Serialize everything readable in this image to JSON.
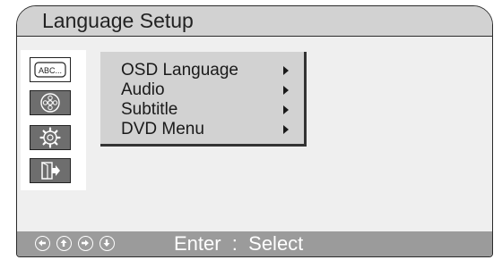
{
  "title": "Language Setup",
  "sidebar": {
    "items": [
      {
        "icon": "abc-language-icon",
        "label": "ABC...",
        "selected": true
      },
      {
        "icon": "disc-icon",
        "selected": false
      },
      {
        "icon": "gear-icon",
        "selected": false
      },
      {
        "icon": "exit-icon",
        "selected": false
      }
    ]
  },
  "submenu": {
    "items": [
      {
        "label": "OSD Language"
      },
      {
        "label": "Audio"
      },
      {
        "label": "Subtitle"
      },
      {
        "label": "DVD Menu"
      }
    ]
  },
  "footer": {
    "nav_keys": [
      "left-arrow-key-icon",
      "up-arrow-key-icon",
      "right-arrow-key-icon",
      "down-arrow-key-icon"
    ],
    "hint": "Enter  :  Select"
  },
  "colors": {
    "background": "#efefef",
    "titlebar": "#d2d2d2",
    "footer": "#9b9b9b",
    "icon_button": "#6e6e6e"
  }
}
